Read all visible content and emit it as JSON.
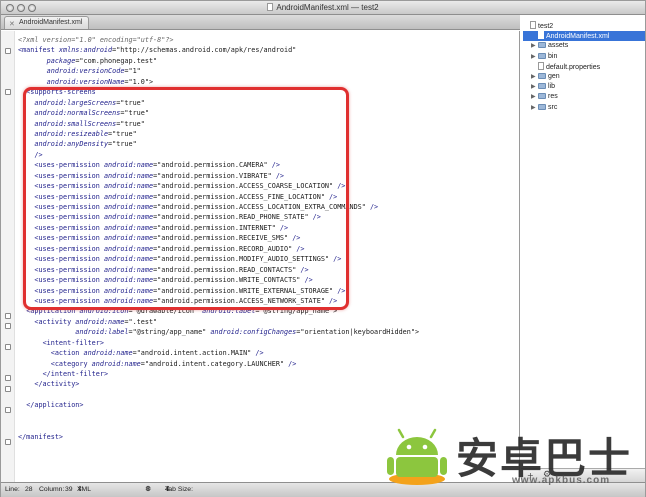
{
  "window": {
    "title": "AndroidManifest.xml — test2"
  },
  "tabs": [
    {
      "label": "AndroidManifest.xml"
    }
  ],
  "code_lines": [
    {
      "indent": 0,
      "parts": [
        {
          "c": "pi",
          "t": "<?xml version=\"1.0\" encoding=\"utf-8\"?>"
        }
      ]
    },
    {
      "indent": 0,
      "parts": [
        {
          "c": "tag",
          "t": "<manifest "
        },
        {
          "c": "attr",
          "t": "xmlns:android"
        },
        {
          "c": "val",
          "t": "=\"http://schemas.android.com/apk/res/android\""
        }
      ]
    },
    {
      "indent": 7,
      "parts": [
        {
          "c": "attr",
          "t": "package"
        },
        {
          "c": "val",
          "t": "=\"com.phonegap.test\""
        }
      ]
    },
    {
      "indent": 7,
      "parts": [
        {
          "c": "attr",
          "t": "android:versionCode"
        },
        {
          "c": "val",
          "t": "=\"1\""
        }
      ]
    },
    {
      "indent": 7,
      "parts": [
        {
          "c": "attr",
          "t": "android:versionName"
        },
        {
          "c": "val",
          "t": "=\"1.0\">"
        }
      ]
    },
    {
      "indent": 2,
      "parts": [
        {
          "c": "tag",
          "t": "<supports-screens"
        }
      ]
    },
    {
      "indent": 4,
      "parts": [
        {
          "c": "attr",
          "t": "android:largeScreens"
        },
        {
          "c": "val",
          "t": "=\"true\""
        }
      ]
    },
    {
      "indent": 4,
      "parts": [
        {
          "c": "attr",
          "t": "android:normalScreens"
        },
        {
          "c": "val",
          "t": "=\"true\""
        }
      ]
    },
    {
      "indent": 4,
      "parts": [
        {
          "c": "attr",
          "t": "android:smallScreens"
        },
        {
          "c": "val",
          "t": "=\"true\""
        }
      ]
    },
    {
      "indent": 4,
      "parts": [
        {
          "c": "attr",
          "t": "android:resizeable"
        },
        {
          "c": "val",
          "t": "=\"true\""
        }
      ]
    },
    {
      "indent": 4,
      "parts": [
        {
          "c": "attr",
          "t": "android:anyDensity"
        },
        {
          "c": "val",
          "t": "=\"true\""
        }
      ]
    },
    {
      "indent": 4,
      "parts": [
        {
          "c": "tag",
          "t": "/>"
        }
      ]
    },
    {
      "indent": 4,
      "parts": [
        {
          "c": "tag",
          "t": "<uses-permission "
        },
        {
          "c": "attr",
          "t": "android:name"
        },
        {
          "c": "val",
          "t": "=\"android.permission.CAMERA\" "
        },
        {
          "c": "tag",
          "t": "/>"
        }
      ]
    },
    {
      "indent": 4,
      "parts": [
        {
          "c": "tag",
          "t": "<uses-permission "
        },
        {
          "c": "attr",
          "t": "android:name"
        },
        {
          "c": "val",
          "t": "=\"android.permission.VIBRATE\" "
        },
        {
          "c": "tag",
          "t": "/>"
        }
      ]
    },
    {
      "indent": 4,
      "parts": [
        {
          "c": "tag",
          "t": "<uses-permission "
        },
        {
          "c": "attr",
          "t": "android:name"
        },
        {
          "c": "val",
          "t": "=\"android.permission.ACCESS_COARSE_LOCATION\" "
        },
        {
          "c": "tag",
          "t": "/>"
        }
      ]
    },
    {
      "indent": 4,
      "parts": [
        {
          "c": "tag",
          "t": "<uses-permission "
        },
        {
          "c": "attr",
          "t": "android:name"
        },
        {
          "c": "val",
          "t": "=\"android.permission.ACCESS_FINE_LOCATION\" "
        },
        {
          "c": "tag",
          "t": "/>"
        }
      ]
    },
    {
      "indent": 4,
      "parts": [
        {
          "c": "tag",
          "t": "<uses-permission "
        },
        {
          "c": "attr",
          "t": "android:name"
        },
        {
          "c": "val",
          "t": "=\"android.permission.ACCESS_LOCATION_EXTRA_COMMANDS\" "
        },
        {
          "c": "tag",
          "t": "/>"
        }
      ]
    },
    {
      "indent": 4,
      "parts": [
        {
          "c": "tag",
          "t": "<uses-permission "
        },
        {
          "c": "attr",
          "t": "android:name"
        },
        {
          "c": "val",
          "t": "=\"android.permission.READ_PHONE_STATE\" "
        },
        {
          "c": "tag",
          "t": "/>"
        }
      ]
    },
    {
      "indent": 4,
      "parts": [
        {
          "c": "tag",
          "t": "<uses-permission "
        },
        {
          "c": "attr",
          "t": "android:name"
        },
        {
          "c": "val",
          "t": "=\"android.permission.INTERNET\" "
        },
        {
          "c": "tag",
          "t": "/>"
        }
      ]
    },
    {
      "indent": 4,
      "parts": [
        {
          "c": "tag",
          "t": "<uses-permission "
        },
        {
          "c": "attr",
          "t": "android:name"
        },
        {
          "c": "val",
          "t": "=\"android.permission.RECEIVE_SMS\" "
        },
        {
          "c": "tag",
          "t": "/>"
        }
      ]
    },
    {
      "indent": 4,
      "parts": [
        {
          "c": "tag",
          "t": "<uses-permission "
        },
        {
          "c": "attr",
          "t": "android:name"
        },
        {
          "c": "val",
          "t": "=\"android.permission.RECORD_AUDIO\" "
        },
        {
          "c": "tag",
          "t": "/>"
        }
      ]
    },
    {
      "indent": 4,
      "parts": [
        {
          "c": "tag",
          "t": "<uses-permission "
        },
        {
          "c": "attr",
          "t": "android:name"
        },
        {
          "c": "val",
          "t": "=\"android.permission.MODIFY_AUDIO_SETTINGS\" "
        },
        {
          "c": "tag",
          "t": "/>"
        }
      ]
    },
    {
      "indent": 4,
      "parts": [
        {
          "c": "tag",
          "t": "<uses-permission "
        },
        {
          "c": "attr",
          "t": "android:name"
        },
        {
          "c": "val",
          "t": "=\"android.permission.READ_CONTACTS\" "
        },
        {
          "c": "tag",
          "t": "/>"
        }
      ]
    },
    {
      "indent": 4,
      "parts": [
        {
          "c": "tag",
          "t": "<uses-permission "
        },
        {
          "c": "attr",
          "t": "android:name"
        },
        {
          "c": "val",
          "t": "=\"android.permission.WRITE_CONTACTS\" "
        },
        {
          "c": "tag",
          "t": "/>"
        }
      ]
    },
    {
      "indent": 4,
      "parts": [
        {
          "c": "tag",
          "t": "<uses-permission "
        },
        {
          "c": "attr",
          "t": "android:name"
        },
        {
          "c": "val",
          "t": "=\"android.permission.WRITE_EXTERNAL_STORAGE\" "
        },
        {
          "c": "tag",
          "t": "/>"
        }
      ]
    },
    {
      "indent": 4,
      "parts": [
        {
          "c": "tag",
          "t": "<uses-permission "
        },
        {
          "c": "attr",
          "t": "android:name"
        },
        {
          "c": "val",
          "t": "=\"android.permission.ACCESS_NETWORK_STATE\" "
        },
        {
          "c": "tag",
          "t": "/>"
        }
      ]
    },
    {
      "indent": 2,
      "parts": [
        {
          "c": "tag",
          "t": "<application "
        },
        {
          "c": "attr",
          "t": "android:icon"
        },
        {
          "c": "val",
          "t": "=\"@drawable/icon\" "
        },
        {
          "c": "attr",
          "t": "android:label"
        },
        {
          "c": "val",
          "t": "=\"@string/app_name\">"
        }
      ]
    },
    {
      "indent": 4,
      "parts": [
        {
          "c": "tag",
          "t": "<activity "
        },
        {
          "c": "attr",
          "t": "android:name"
        },
        {
          "c": "val",
          "t": "=\".test\""
        }
      ]
    },
    {
      "indent": 14,
      "parts": [
        {
          "c": "attr",
          "t": "android:label"
        },
        {
          "c": "val",
          "t": "=\"@string/app_name\" "
        },
        {
          "c": "attr",
          "t": "android:configChanges"
        },
        {
          "c": "val",
          "t": "=\"orientation|keyboardHidden\">"
        }
      ]
    },
    {
      "indent": 6,
      "parts": [
        {
          "c": "tag",
          "t": "<intent-filter>"
        }
      ]
    },
    {
      "indent": 8,
      "parts": [
        {
          "c": "tag",
          "t": "<action "
        },
        {
          "c": "attr",
          "t": "android:name"
        },
        {
          "c": "val",
          "t": "=\"android.intent.action.MAIN\" "
        },
        {
          "c": "tag",
          "t": "/>"
        }
      ]
    },
    {
      "indent": 8,
      "parts": [
        {
          "c": "tag",
          "t": "<category "
        },
        {
          "c": "attr",
          "t": "android:name"
        },
        {
          "c": "val",
          "t": "=\"android.intent.category.LAUNCHER\" "
        },
        {
          "c": "tag",
          "t": "/>"
        }
      ]
    },
    {
      "indent": 6,
      "parts": [
        {
          "c": "tag",
          "t": "</intent-filter>"
        }
      ]
    },
    {
      "indent": 4,
      "parts": [
        {
          "c": "tag",
          "t": "</activity>"
        }
      ]
    },
    {
      "indent": 0,
      "parts": []
    },
    {
      "indent": 2,
      "parts": [
        {
          "c": "tag",
          "t": "</application>"
        }
      ]
    },
    {
      "indent": 0,
      "parts": []
    },
    {
      "indent": 0,
      "parts": []
    },
    {
      "indent": 0,
      "parts": [
        {
          "c": "tag",
          "t": "</manifest>"
        }
      ]
    }
  ],
  "project_tree": [
    {
      "label": "test2",
      "level": 0,
      "kind": "file",
      "disclosure": "",
      "selected": false
    },
    {
      "label": "AndroidManifest.xml",
      "level": 1,
      "kind": "file",
      "disclosure": "",
      "selected": true
    },
    {
      "label": "assets",
      "level": 1,
      "kind": "folder",
      "disclosure": "▶",
      "selected": false
    },
    {
      "label": "bin",
      "level": 1,
      "kind": "folder",
      "disclosure": "▶",
      "selected": false
    },
    {
      "label": "default.properties",
      "level": 1,
      "kind": "file",
      "disclosure": "",
      "selected": false
    },
    {
      "label": "gen",
      "level": 1,
      "kind": "folder",
      "disclosure": "▶",
      "selected": false
    },
    {
      "label": "lib",
      "level": 1,
      "kind": "folder",
      "disclosure": "▶",
      "selected": false
    },
    {
      "label": "res",
      "level": 1,
      "kind": "folder",
      "disclosure": "▶",
      "selected": false
    },
    {
      "label": "src",
      "level": 1,
      "kind": "folder",
      "disclosure": "▶",
      "selected": false
    }
  ],
  "pane_footer": {
    "add_label": "+",
    "gear_label": "⚙"
  },
  "status": {
    "line_label": "Line:",
    "line_value": "28",
    "column_label": "Column:",
    "column_value": "39",
    "language": "XML",
    "tab_size_label": "Tab Size:",
    "tab_size_value": "4"
  },
  "watermark": {
    "text": "安卓巴士",
    "url": "www.apkbus.com"
  },
  "colors": {
    "highlight": "#e03030",
    "selection": "#3874d8",
    "tag": "#1e1e8a"
  }
}
